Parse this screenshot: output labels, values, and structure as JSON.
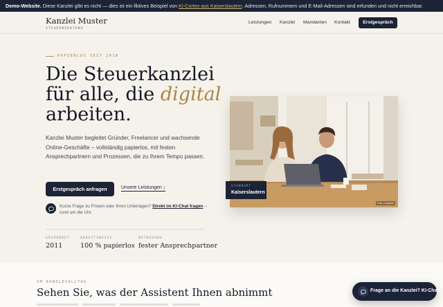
{
  "banner": {
    "prefix": "Demo-Website.",
    "text1": " Diese Kanzlei gibt es nicht — dies ist ein fiktives Beispiel von ",
    "link": "KI-Cortex aus Kaiserslautern",
    "text2": ". Adressen, Rufnummern und E-Mail-Adressen sind erfunden und nicht erreichbar."
  },
  "header": {
    "logo_name": "Kanzlei Muster",
    "logo_sub": "STEUERBERATUNG",
    "nav": [
      "Leistungen",
      "Kanzlei",
      "Mandanten",
      "Kontakt"
    ],
    "cta": "Erstgespräch"
  },
  "hero": {
    "eyebrow": "PAPIERLOS SEIT 2018",
    "line1": "Die Steuerkanzlei",
    "line2_pre": "für alle, die ",
    "line2_accent": "digital",
    "line3": "arbeiten.",
    "lead": "Kanzlei Muster begleitet Gründer, Freelancer und wachsende Online-Geschäfte – vollständig papierlos, mit festen Ansprechpartnern und Prozessen, die zu Ihrem Tempo passen.",
    "primary_btn": "Erstgespräch anfragen",
    "secondary_btn": "Unsere Leistungen ↓",
    "chat_note_pre": "Kurze Frage zu Fristen oder Ihren Unterlagen? ",
    "chat_note_link": "Direkt im KI-Chat fragen",
    "chat_note_post": " – rund um die Uhr."
  },
  "stats": [
    {
      "label": "GEGRÜNDET",
      "value": "2011"
    },
    {
      "label": "ARBEITSWEISE",
      "value": "100 % papierlos"
    },
    {
      "label": "BETREUUNG",
      "value": "fester Ansprechpartner"
    }
  ],
  "photo": {
    "tag_label": "STANDORT",
    "tag_value": "Kaiserslautern",
    "credit": "Foto: Unsplash"
  },
  "section2": {
    "eyebrow": "IM KANZLEIALLTAG",
    "title": "Sehen Sie, was der Assistent Ihnen abnimmt"
  },
  "chat_fab": {
    "label": "Frage an die Kanzlei? KI-Chat"
  },
  "colors": {
    "navy": "#1b2336",
    "gold": "#a98544",
    "background": "#f5f2ec"
  }
}
